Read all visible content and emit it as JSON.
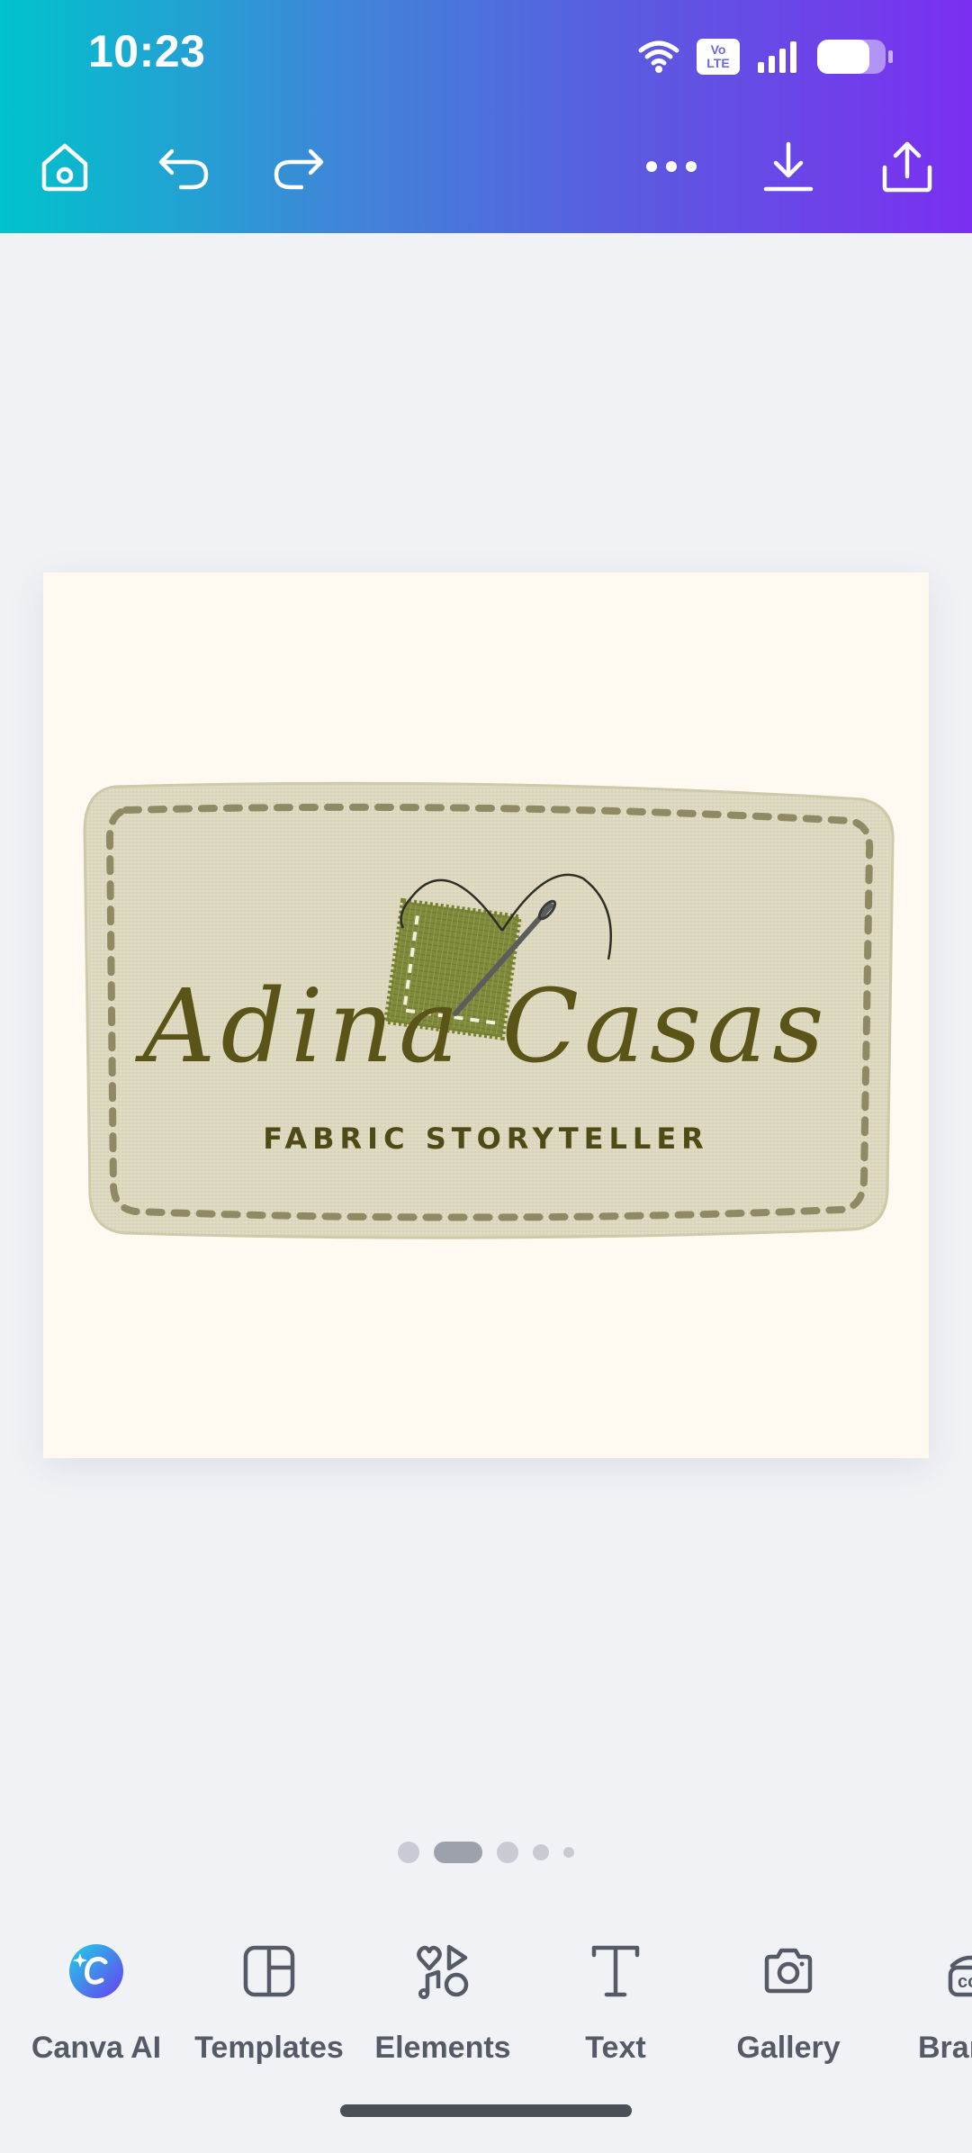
{
  "status_bar": {
    "time": "10:23",
    "volte_line1": "Vo",
    "volte_line2": "LTE",
    "icons": [
      "wifi-icon",
      "volte-icon",
      "signal-icon",
      "battery-icon"
    ]
  },
  "toolbar": {
    "buttons": [
      "home-icon",
      "undo-icon",
      "redo-icon",
      "more-icon",
      "download-icon",
      "share-icon"
    ]
  },
  "design": {
    "name": "Adina Casas",
    "tagline": "FABRIC STORYTELLER",
    "colors": {
      "page": "#fff9f1",
      "patch": "#ddd8bf",
      "stitch": "#8f8a64",
      "text": "#5a5418",
      "fabric_square": "#7f8a3c"
    }
  },
  "pager": {
    "count": 5,
    "active_index": 1
  },
  "bottom_tools": [
    {
      "label": "Canva AI",
      "icon": "canva-ai-icon"
    },
    {
      "label": "Templates",
      "icon": "templates-icon"
    },
    {
      "label": "Elements",
      "icon": "elements-icon"
    },
    {
      "label": "Text",
      "icon": "text-icon"
    },
    {
      "label": "Gallery",
      "icon": "camera-icon"
    },
    {
      "label": "Bran",
      "icon": "brand-icon"
    }
  ],
  "theme": {
    "gradient_start": "#00c3cc",
    "gradient_end": "#7b2ff0",
    "background": "#f1f2f6"
  }
}
